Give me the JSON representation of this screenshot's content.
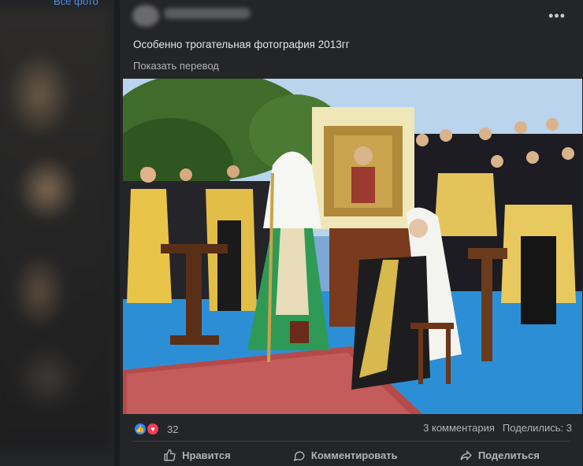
{
  "sidebar": {
    "top_link": "Все фото"
  },
  "post": {
    "more_icon": "more-horizontal-icon",
    "caption": "Особенно трогательная фотография 2013гг",
    "translate_link": "Показать перевод",
    "photo_alt": "Патриарх в зелёном облачении стоит рядом с сидящим иерархом в белом клобуке; за ними икона в цветах и духовенство"
  },
  "footer": {
    "reaction_count": "32",
    "comments_count": "3 комментария",
    "shares_count": "Поделились: 3",
    "actions": {
      "like": "Нравится",
      "comment": "Комментировать",
      "share": "Поделиться"
    }
  },
  "colors": {
    "background": "#242526",
    "link": "#4b8ee8",
    "like": "#2d88ff",
    "love": "#f33e58",
    "secondary_text": "#b0b3b8"
  }
}
